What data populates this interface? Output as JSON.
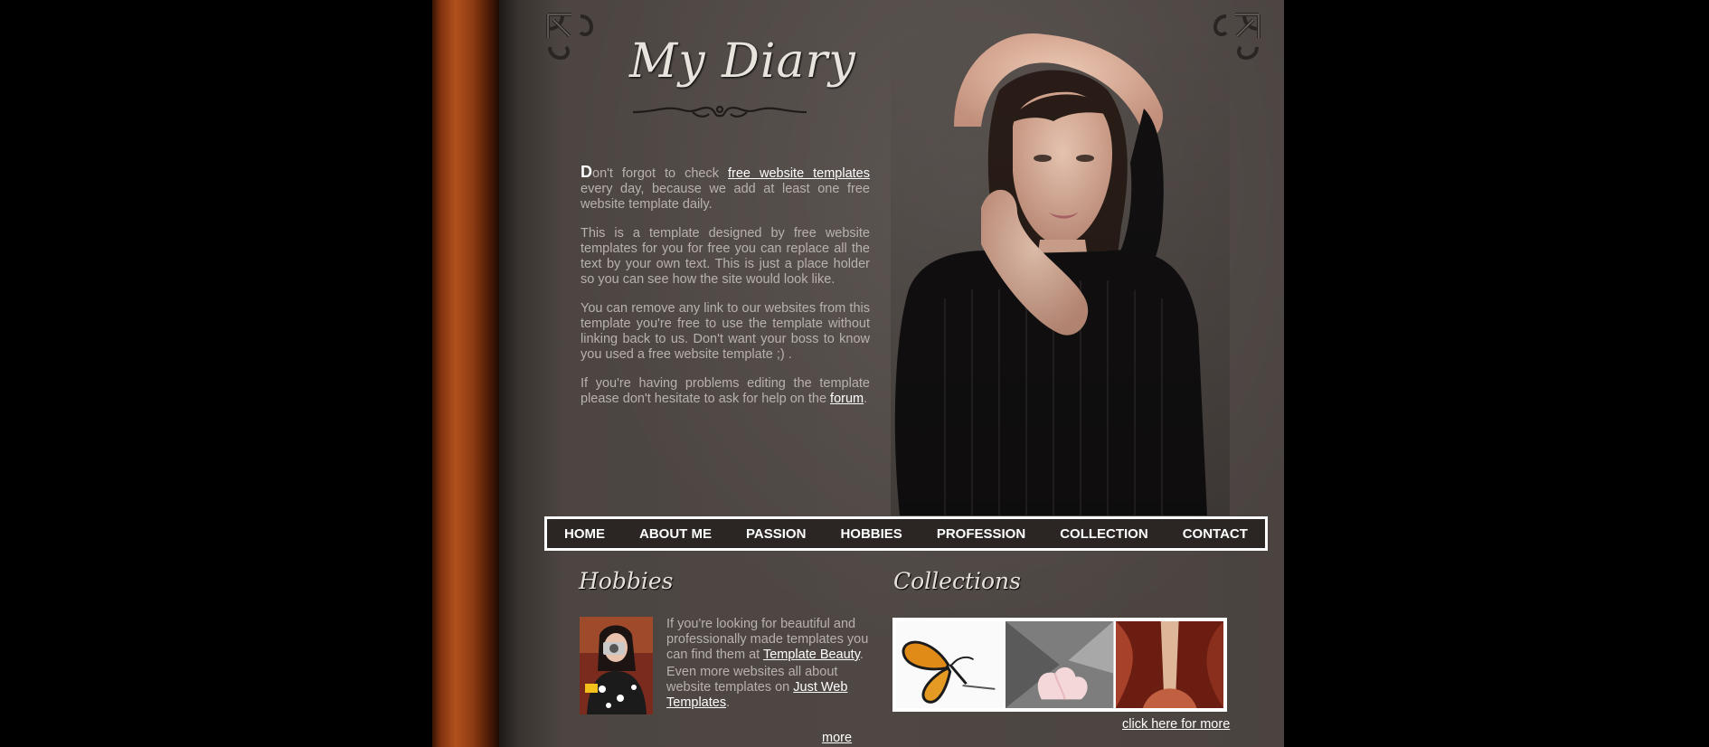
{
  "site": {
    "logo_text": "My Diary"
  },
  "intro": {
    "dropcap": "D",
    "p1_text": "on't forgot to check",
    "p1_link": "free website templates",
    "p1_rest": "every day, because we add at least one free website template daily.",
    "p2": "This is a template designed by free website templates for you for free you can replace all the text by your own text. This is just a place holder so you can see how the site would look like.",
    "p3": "You can remove any link to our websites from this template you're free to use the template without linking back to us. Don't want your boss to know you used a free website template ;) .",
    "p4_text": "If you're having problems editing the template please don't hesitate to ask for help on the",
    "p4_link": "forum",
    "p4_end": "."
  },
  "nav": {
    "items": [
      "HOME",
      "ABOUT ME",
      "PASSION",
      "HOBBIES",
      "PROFESSION",
      "COLLECTION",
      "CONTACT"
    ]
  },
  "hobbies": {
    "title": "Hobbies",
    "text1": "If you're looking for beautiful and professionally made templates you can find them at",
    "link1": "Template Beauty",
    "end1": ".",
    "text2": "Even more websites all about website templates on",
    "link2": "Just Web Templates",
    "end2": ".",
    "more": "more"
  },
  "collections": {
    "title": "Collections",
    "more": "click here for more"
  },
  "colors": {
    "page_bg": "#4e4743",
    "spine": "#b1511c",
    "text": "#b9b2ab",
    "link": "#ffffff"
  },
  "icons": [
    "corner-ornament-icon",
    "flourish-divider-icon"
  ]
}
